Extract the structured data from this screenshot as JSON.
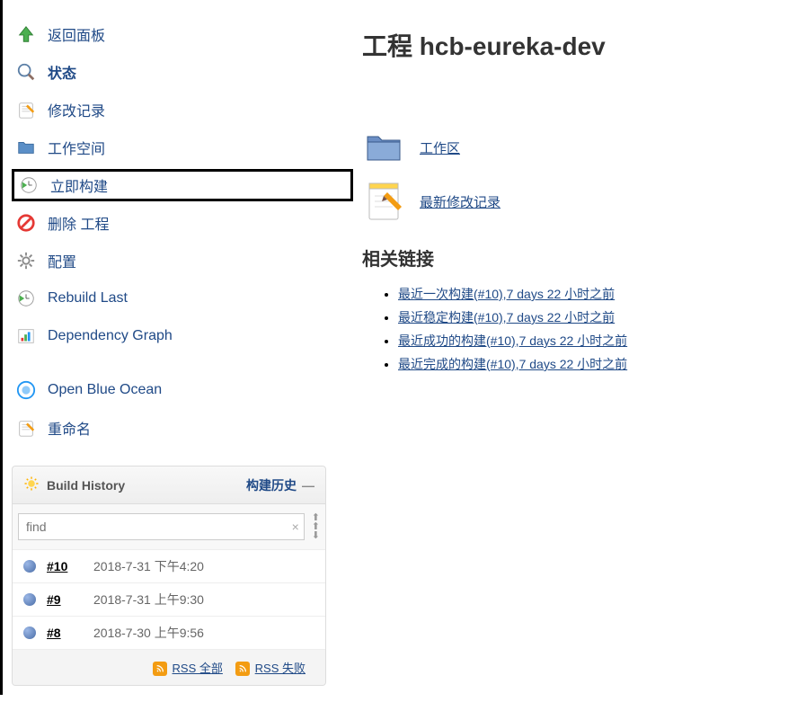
{
  "sidebar": {
    "items": [
      {
        "label": "返回面板",
        "icon": "up-arrow"
      },
      {
        "label": "状态",
        "icon": "search",
        "bold": true
      },
      {
        "label": "修改记录",
        "icon": "notepad"
      },
      {
        "label": "工作空间",
        "icon": "folder"
      },
      {
        "label": "立即构建",
        "icon": "clock-play",
        "highlighted": true
      },
      {
        "label": "删除 工程",
        "icon": "forbidden"
      },
      {
        "label": "配置",
        "icon": "gear"
      },
      {
        "label": "Rebuild Last",
        "icon": "clock-play"
      },
      {
        "label": "Dependency Graph",
        "icon": "graph"
      },
      {
        "label": "Open Blue Ocean",
        "icon": "blue-circle"
      },
      {
        "label": "重命名",
        "icon": "notepad"
      }
    ]
  },
  "page": {
    "title": "工程 hcb-eureka-dev"
  },
  "mainLinks": {
    "workspace": "工作区",
    "changes": "最新修改记录"
  },
  "related": {
    "title": "相关链接",
    "items": [
      "最近一次构建(#10),7 days 22 小时之前",
      "最近稳定构建(#10),7 days 22 小时之前",
      "最近成功的构建(#10),7 days 22 小时之前",
      "最近完成的构建(#10),7 days 22 小时之前"
    ]
  },
  "buildHistory": {
    "title": "Build History",
    "subtitle": "构建历史",
    "searchPlaceholder": "find",
    "builds": [
      {
        "num": "#10",
        "date": "2018-7-31 下午4:20"
      },
      {
        "num": "#9",
        "date": "2018-7-31 上午9:30"
      },
      {
        "num": "#8",
        "date": "2018-7-30 上午9:56"
      }
    ],
    "rssAll": "RSS 全部",
    "rssFail": "RSS 失败"
  }
}
